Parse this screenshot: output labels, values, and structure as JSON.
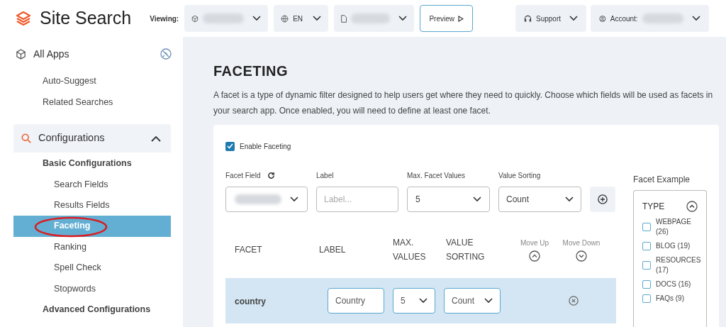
{
  "header": {
    "logo_text": "Site Search",
    "viewing_label": "Viewing:",
    "language": "EN",
    "preview": "Preview",
    "support": "Support",
    "account_label": "Account:"
  },
  "sidebar": {
    "all_apps": "All Apps",
    "items": [
      {
        "label": "Auto-Suggest",
        "selected": false
      },
      {
        "label": "Related Searches",
        "selected": false
      }
    ],
    "configurations": {
      "label": "Configurations",
      "expanded": true,
      "items": [
        {
          "label": "Basic Configurations",
          "kind": "heading",
          "selected": false,
          "circled": false
        },
        {
          "label": "Search Fields",
          "kind": "link",
          "selected": false,
          "circled": false
        },
        {
          "label": "Results Fields",
          "kind": "link",
          "selected": false,
          "circled": false
        },
        {
          "label": "Faceting",
          "kind": "link",
          "selected": true,
          "circled": true
        },
        {
          "label": "Ranking",
          "kind": "link",
          "selected": false,
          "circled": false
        },
        {
          "label": "Spell Check",
          "kind": "link",
          "selected": false,
          "circled": false
        },
        {
          "label": "Stopwords",
          "kind": "link",
          "selected": false,
          "circled": false
        },
        {
          "label": "Advanced Configurations",
          "kind": "heading",
          "selected": false,
          "circled": false
        }
      ]
    }
  },
  "main": {
    "title": "FACETING",
    "description": "A facet is a type of dynamic filter designed to help users get where they need to quickly. Choose which fields will be used as facets in your search app. Once enabled, you will need to define at least one facet.",
    "enable_faceting": {
      "label": "Enable Faceting",
      "checked": true
    },
    "form": {
      "facet_field_label": "Facet Field",
      "label_label": "Label",
      "label_placeholder": "Label...",
      "max_label": "Max. Facet Values",
      "max_value": "5",
      "sorting_label": "Value Sorting",
      "sorting_value": "Count"
    },
    "table": {
      "columns": [
        "FACET",
        "LABEL",
        "MAX. VALUES",
        "VALUE SORTING",
        "Move Up",
        "Move Down"
      ],
      "rows": [
        {
          "facet": "country",
          "label": "Country",
          "max": "5",
          "sorting": "Count",
          "selected": true
        }
      ]
    },
    "facet_example": {
      "title": "Facet Example",
      "group": "TYPE",
      "options": [
        {
          "label": "WEBPAGE (26)",
          "checked": false
        },
        {
          "label": "BLOG (19)",
          "checked": false
        },
        {
          "label": "RESOURCES (17)",
          "checked": false
        },
        {
          "label": "DOCS (16)",
          "checked": false
        },
        {
          "label": "FAQs (9)",
          "checked": false
        }
      ]
    }
  }
}
